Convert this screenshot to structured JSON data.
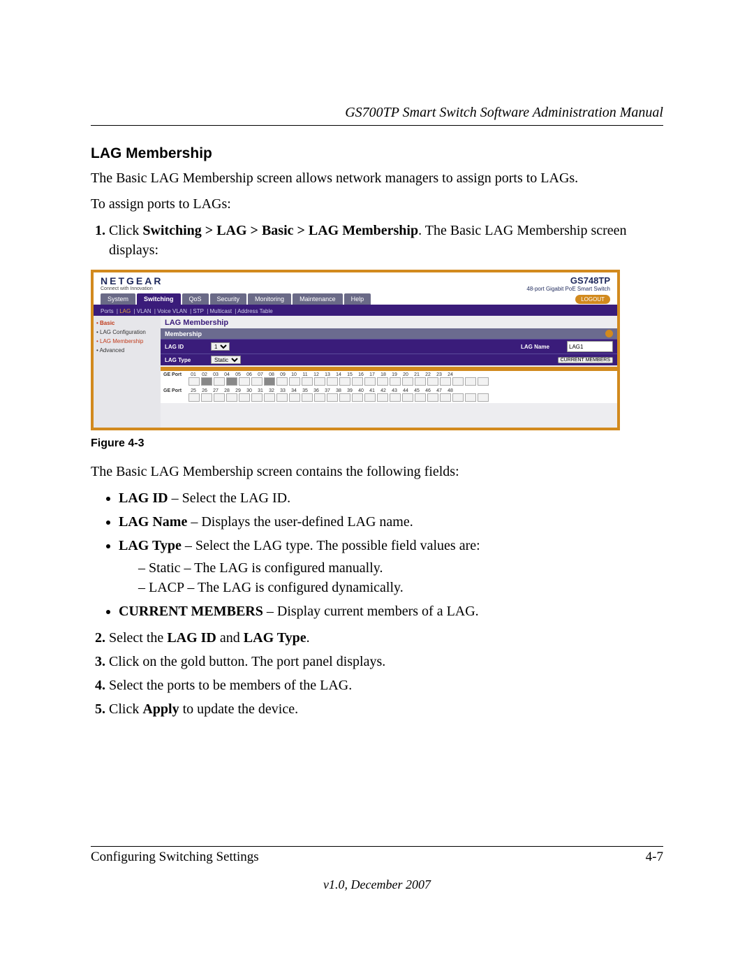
{
  "header": {
    "running": "GS700TP Smart Switch Software Administration Manual"
  },
  "section_title": "LAG Membership",
  "intro_1": "The Basic LAG Membership screen allows network managers to assign ports to LAGs.",
  "intro_2": "To assign ports to LAGs:",
  "step1_pre": "Click ",
  "step1_bold": "Switching > LAG > Basic > LAG Membership",
  "step1_post": ". The Basic LAG Membership screen displays:",
  "fig": {
    "brand": "NETGEAR",
    "brand_sub": "Connect with Innovation",
    "model": "GS748TP",
    "model_sub": "48-port Gigabit PoE Smart Switch",
    "tabs": [
      "System",
      "Switching",
      "QoS",
      "Security",
      "Monitoring",
      "Maintenance",
      "Help"
    ],
    "active_tab": 1,
    "logout": "LOGOUT",
    "subnav": [
      "Ports",
      "LAG",
      "VLAN",
      "Voice VLAN",
      "STP",
      "Multicast",
      "Address Table"
    ],
    "subnav_active": 1,
    "side": [
      "• Basic",
      "• LAG Configuration",
      "• LAG Membership",
      "• Advanced"
    ],
    "side_cur": 2,
    "panel_title": "LAG Membership",
    "panel_head": "Membership",
    "lag_id_label": "LAG ID",
    "lag_id_value": "1",
    "lag_name_label": "LAG Name",
    "lag_name_value": "LAG1",
    "lag_type_label": "LAG Type",
    "lag_type_value": "Static",
    "current_members": "CURRENT MEMBERS",
    "row_label": "GE Port",
    "row1": [
      "01",
      "02",
      "03",
      "04",
      "05",
      "06",
      "07",
      "08",
      "09",
      "10",
      "11",
      "12",
      "13",
      "14",
      "15",
      "16",
      "17",
      "18",
      "19",
      "20",
      "21",
      "22",
      "23",
      "24"
    ],
    "row2": [
      "25",
      "26",
      "27",
      "28",
      "29",
      "30",
      "31",
      "32",
      "33",
      "34",
      "35",
      "36",
      "37",
      "38",
      "39",
      "40",
      "41",
      "42",
      "43",
      "44",
      "45",
      "46",
      "47",
      "48"
    ],
    "selected_ports": [
      2,
      4,
      7
    ]
  },
  "figcaption": "Figure 4-3",
  "after_fig": "The Basic LAG Membership screen contains the following fields:",
  "b_lagid_b": "LAG ID",
  "b_lagid_t": " – Select the LAG ID.",
  "b_lagname_b": "LAG Name",
  "b_lagname_t": " – Displays the user-defined LAG name.",
  "b_lagtype_b": "LAG Type",
  "b_lagtype_t": " – Select the LAG type. The possible field values are:",
  "d_static": "Static – The LAG is configured manually.",
  "d_lacp": "LACP – The LAG is configured dynamically.",
  "b_cm_b": "CURRENT MEMBERS",
  "b_cm_t": " – Display current members of a LAG.",
  "s2_pre": "Select the ",
  "s2_b1": "LAG ID",
  "s2_mid": " and ",
  "s2_b2": "LAG Type",
  "s2_post": ".",
  "s3": "Click on the gold button. The port panel displays.",
  "s4": "Select the ports to be members of the LAG.",
  "s5_pre": "Click ",
  "s5_b": "Apply",
  "s5_post": " to update the device.",
  "footer": {
    "left": "Configuring Switching Settings",
    "right": "4-7",
    "version": "v1.0, December 2007"
  }
}
